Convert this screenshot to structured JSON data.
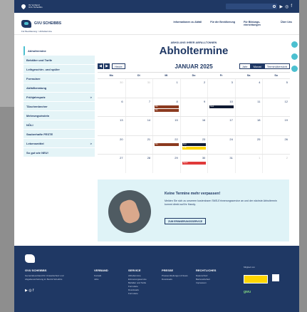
{
  "topbar": {
    "location_line1": "Ihr Verband",
    "location_line2": "GVU Scheibbs"
  },
  "logo": {
    "text": "GVU SCHEIBBS"
  },
  "breadcrumb": "Für Bevölkerung > Abholtermine",
  "nav": [
    {
      "label": "Informationen zu Abfall"
    },
    {
      "label": "Für die Bevölkerung"
    },
    {
      "label": "Für Bildungs-einrichtungen"
    },
    {
      "label": "Über Uns"
    }
  ],
  "sidebar": {
    "items": [
      {
        "label": "Abholtermine",
        "active": true,
        "arrow": ""
      },
      {
        "label": "Behälter und Tarife",
        "arrow": ""
      },
      {
        "label": "Leihgeschirr- und spüler",
        "arrow": ""
      },
      {
        "label": "Formulare",
        "arrow": ""
      },
      {
        "label": "Abfallberatung",
        "arrow": ""
      },
      {
        "label": "Frühjahrsputz",
        "arrow": ">"
      },
      {
        "label": "TAschenbecher",
        "arrow": ""
      },
      {
        "label": "Mehrwegwindeln",
        "arrow": ""
      },
      {
        "label": "NÖLI",
        "arrow": ""
      },
      {
        "label": "Sauberhafte FESTE",
        "arrow": ""
      },
      {
        "label": "Lebensmittel",
        "arrow": ">"
      },
      {
        "label": "So gut wie NEU!",
        "arrow": ""
      }
    ]
  },
  "main": {
    "kicker": "ABHOLUNG IHRER ABFALLTONNEN",
    "title": "Abholtermine",
    "today_label": "Heute",
    "month_title": "JANUAR 2025",
    "views": [
      {
        "label": "Jahr",
        "active": false
      },
      {
        "label": "Monat",
        "active": true
      },
      {
        "label": "Terminübersicht",
        "active": false
      }
    ],
    "weekdays": [
      "Mo",
      "Di",
      "Mi",
      "Do",
      "Fr",
      "Sa",
      "So"
    ],
    "weeks": [
      [
        {
          "day": "30",
          "muted": true
        },
        {
          "day": "31",
          "muted": true
        },
        {
          "day": "1"
        },
        {
          "day": "2"
        },
        {
          "day": "3"
        },
        {
          "day": "4"
        },
        {
          "day": "5"
        }
      ],
      [
        {
          "day": "6"
        },
        {
          "day": "7"
        },
        {
          "day": "8",
          "events": [
            {
              "label": "Bio",
              "color": "brown"
            },
            {
              "label": "Bio",
              "color": "brown"
            }
          ]
        },
        {
          "day": "9"
        },
        {
          "day": "10",
          "events": [
            {
              "label": "Rest",
              "color": "navy"
            }
          ]
        },
        {
          "day": "11"
        },
        {
          "day": "12"
        }
      ],
      [
        {
          "day": "13"
        },
        {
          "day": "14"
        },
        {
          "day": "15"
        },
        {
          "day": "16"
        },
        {
          "day": "17"
        },
        {
          "day": "18"
        },
        {
          "day": "19"
        }
      ],
      [
        {
          "day": "20"
        },
        {
          "day": "21"
        },
        {
          "day": "22",
          "events": [
            {
              "label": "Bio",
              "color": "brown"
            }
          ]
        },
        {
          "day": "23",
          "events": [
            {
              "label": "Rest",
              "color": "navy"
            },
            {
              "label": "Gelb",
              "color": "yellow"
            }
          ]
        },
        {
          "day": "24"
        },
        {
          "day": "25"
        },
        {
          "day": "26"
        }
      ],
      [
        {
          "day": "27"
        },
        {
          "day": "28"
        },
        {
          "day": "29"
        },
        {
          "day": "30",
          "events": [
            {
              "label": "Papier",
              "color": "red"
            }
          ]
        },
        {
          "day": "31"
        },
        {
          "day": "1",
          "muted": true
        },
        {
          "day": "2",
          "muted": true
        }
      ]
    ]
  },
  "promo": {
    "title": "Keine Termine mehr verpassen!",
    "text": "Melden Sie sich zu unserem kostenlosen SMS-Erinnerungsservice an und der nächste Abholtermin kommt direkt auf Ihr Handy.",
    "button": "ZUM ERINNERUNGSSERVICE"
  },
  "footer": {
    "columns": [
      {
        "heading": "GVU SCHEIBBS",
        "links": [
          "Gemeindeverband für Umweltschutz und Abgabeneinhebung im Bezirk Scheibbs"
        ]
      },
      {
        "heading": "VERBAND",
        "links": [
          "Kontakt",
          "Jobs"
        ]
      },
      {
        "heading": "SERVICE",
        "links": [
          "Abholtermine",
          "Erinnerungsservice",
          "Behälter und Tarife",
          "Formulare",
          "Downloads",
          "Formulare"
        ]
      },
      {
        "heading": "PRESSE",
        "links": [
          "Pressemitteilungen & News",
          "Downloads"
        ]
      },
      {
        "heading": "RECHTLICHES",
        "links": [
          "Datenschutz",
          "Barrierefreiheit",
          "Impressum"
        ]
      },
      {
        "heading": "Mitglied von",
        "links": []
      }
    ],
    "badge_yellow": "Umweltverbände",
    "badge_green": "gwu"
  },
  "colors": {
    "primary": "#1f3864",
    "accent": "#4cc0d0",
    "bio": "#8b3a1f",
    "rest": "#0f1a33",
    "gelb": "#ffd500",
    "papier": "#e03a3a"
  }
}
